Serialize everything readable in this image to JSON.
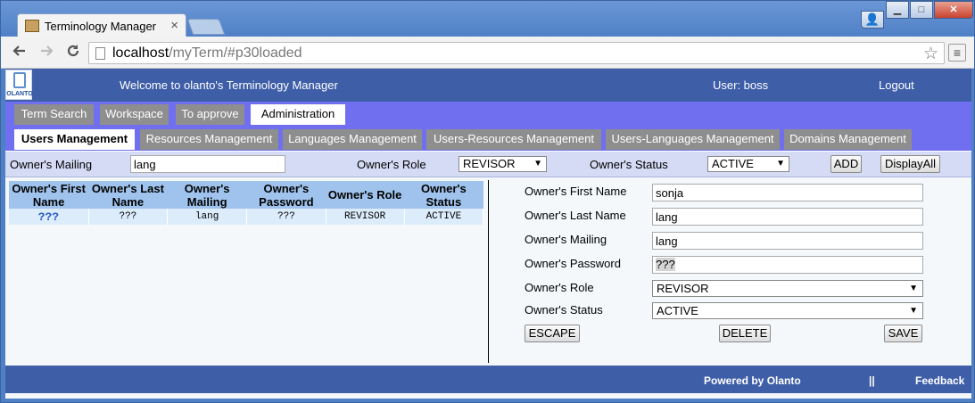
{
  "browser": {
    "tab_title": "Terminology Manager",
    "tab_close": "×",
    "url_host": "localhost",
    "url_path": "/myTerm/#p30loaded",
    "icons": {
      "back": "back-arrow-icon",
      "forward": "forward-arrow-icon",
      "reload": "reload-icon",
      "star": "bookmark-star-icon",
      "menu": "menu-icon"
    },
    "window_controls": {
      "user": "👤",
      "minimize": "▁",
      "maximize": "□",
      "close": "✕"
    }
  },
  "header": {
    "logo_text": "OLANTO",
    "welcome": "Welcome to olanto's Terminology Manager",
    "user": "User: boss",
    "logout": "Logout"
  },
  "main_tabs": [
    {
      "label": "Term Search",
      "active": false
    },
    {
      "label": "Workspace",
      "active": false
    },
    {
      "label": "To approve",
      "active": false
    },
    {
      "label": "Administration",
      "active": true
    }
  ],
  "sub_tabs": [
    {
      "label": "Users Management",
      "active": true
    },
    {
      "label": "Resources Management",
      "active": false
    },
    {
      "label": "Languages Management",
      "active": false
    },
    {
      "label": "Users-Resources Management",
      "active": false
    },
    {
      "label": "Users-Languages Management",
      "active": false
    },
    {
      "label": "Domains Management",
      "active": false
    }
  ],
  "filter": {
    "mailing_label": "Owner's Mailing",
    "mailing_value": "lang",
    "role_label": "Owner's Role",
    "role_value": "REVISOR",
    "status_label": "Owner's Status",
    "status_value": "ACTIVE",
    "add_button": "ADD",
    "display_all_button": "DisplayAll"
  },
  "table": {
    "headers": [
      [
        "Owner's First",
        "Name"
      ],
      [
        "Owner's Last",
        "Name"
      ],
      [
        "Owner's",
        "Mailing"
      ],
      [
        "Owner's",
        "Password"
      ],
      [
        "Owner's Role"
      ],
      [
        "Owner's",
        "Status"
      ]
    ],
    "rows": [
      [
        "???",
        "???",
        "lang",
        "???",
        "REVISOR",
        "ACTIVE"
      ]
    ]
  },
  "form": {
    "first_name_label": "Owner's First Name",
    "first_name_value": "sonja",
    "last_name_label": "Owner's Last Name",
    "last_name_value": "lang",
    "mailing_label": "Owner's Mailing",
    "mailing_value": "lang",
    "password_label": "Owner's Password",
    "password_value": "???",
    "role_label": "Owner's Role",
    "role_value": "REVISOR",
    "status_label": "Owner's Status",
    "status_value": "ACTIVE",
    "escape_button": "ESCAPE",
    "delete_button": "DELETE",
    "save_button": "SAVE"
  },
  "footer": {
    "powered": "Powered by Olanto",
    "separator": "||",
    "feedback": "Feedback"
  },
  "colors": {
    "header_blue": "#3e5ea8",
    "tabbar_purple": "#6f6ff0",
    "inactive_tab_gray": "#8e8e8e",
    "filter_bg": "#d5dbf4",
    "table_header": "#9fc3ec",
    "table_row": "#dcecfb"
  }
}
